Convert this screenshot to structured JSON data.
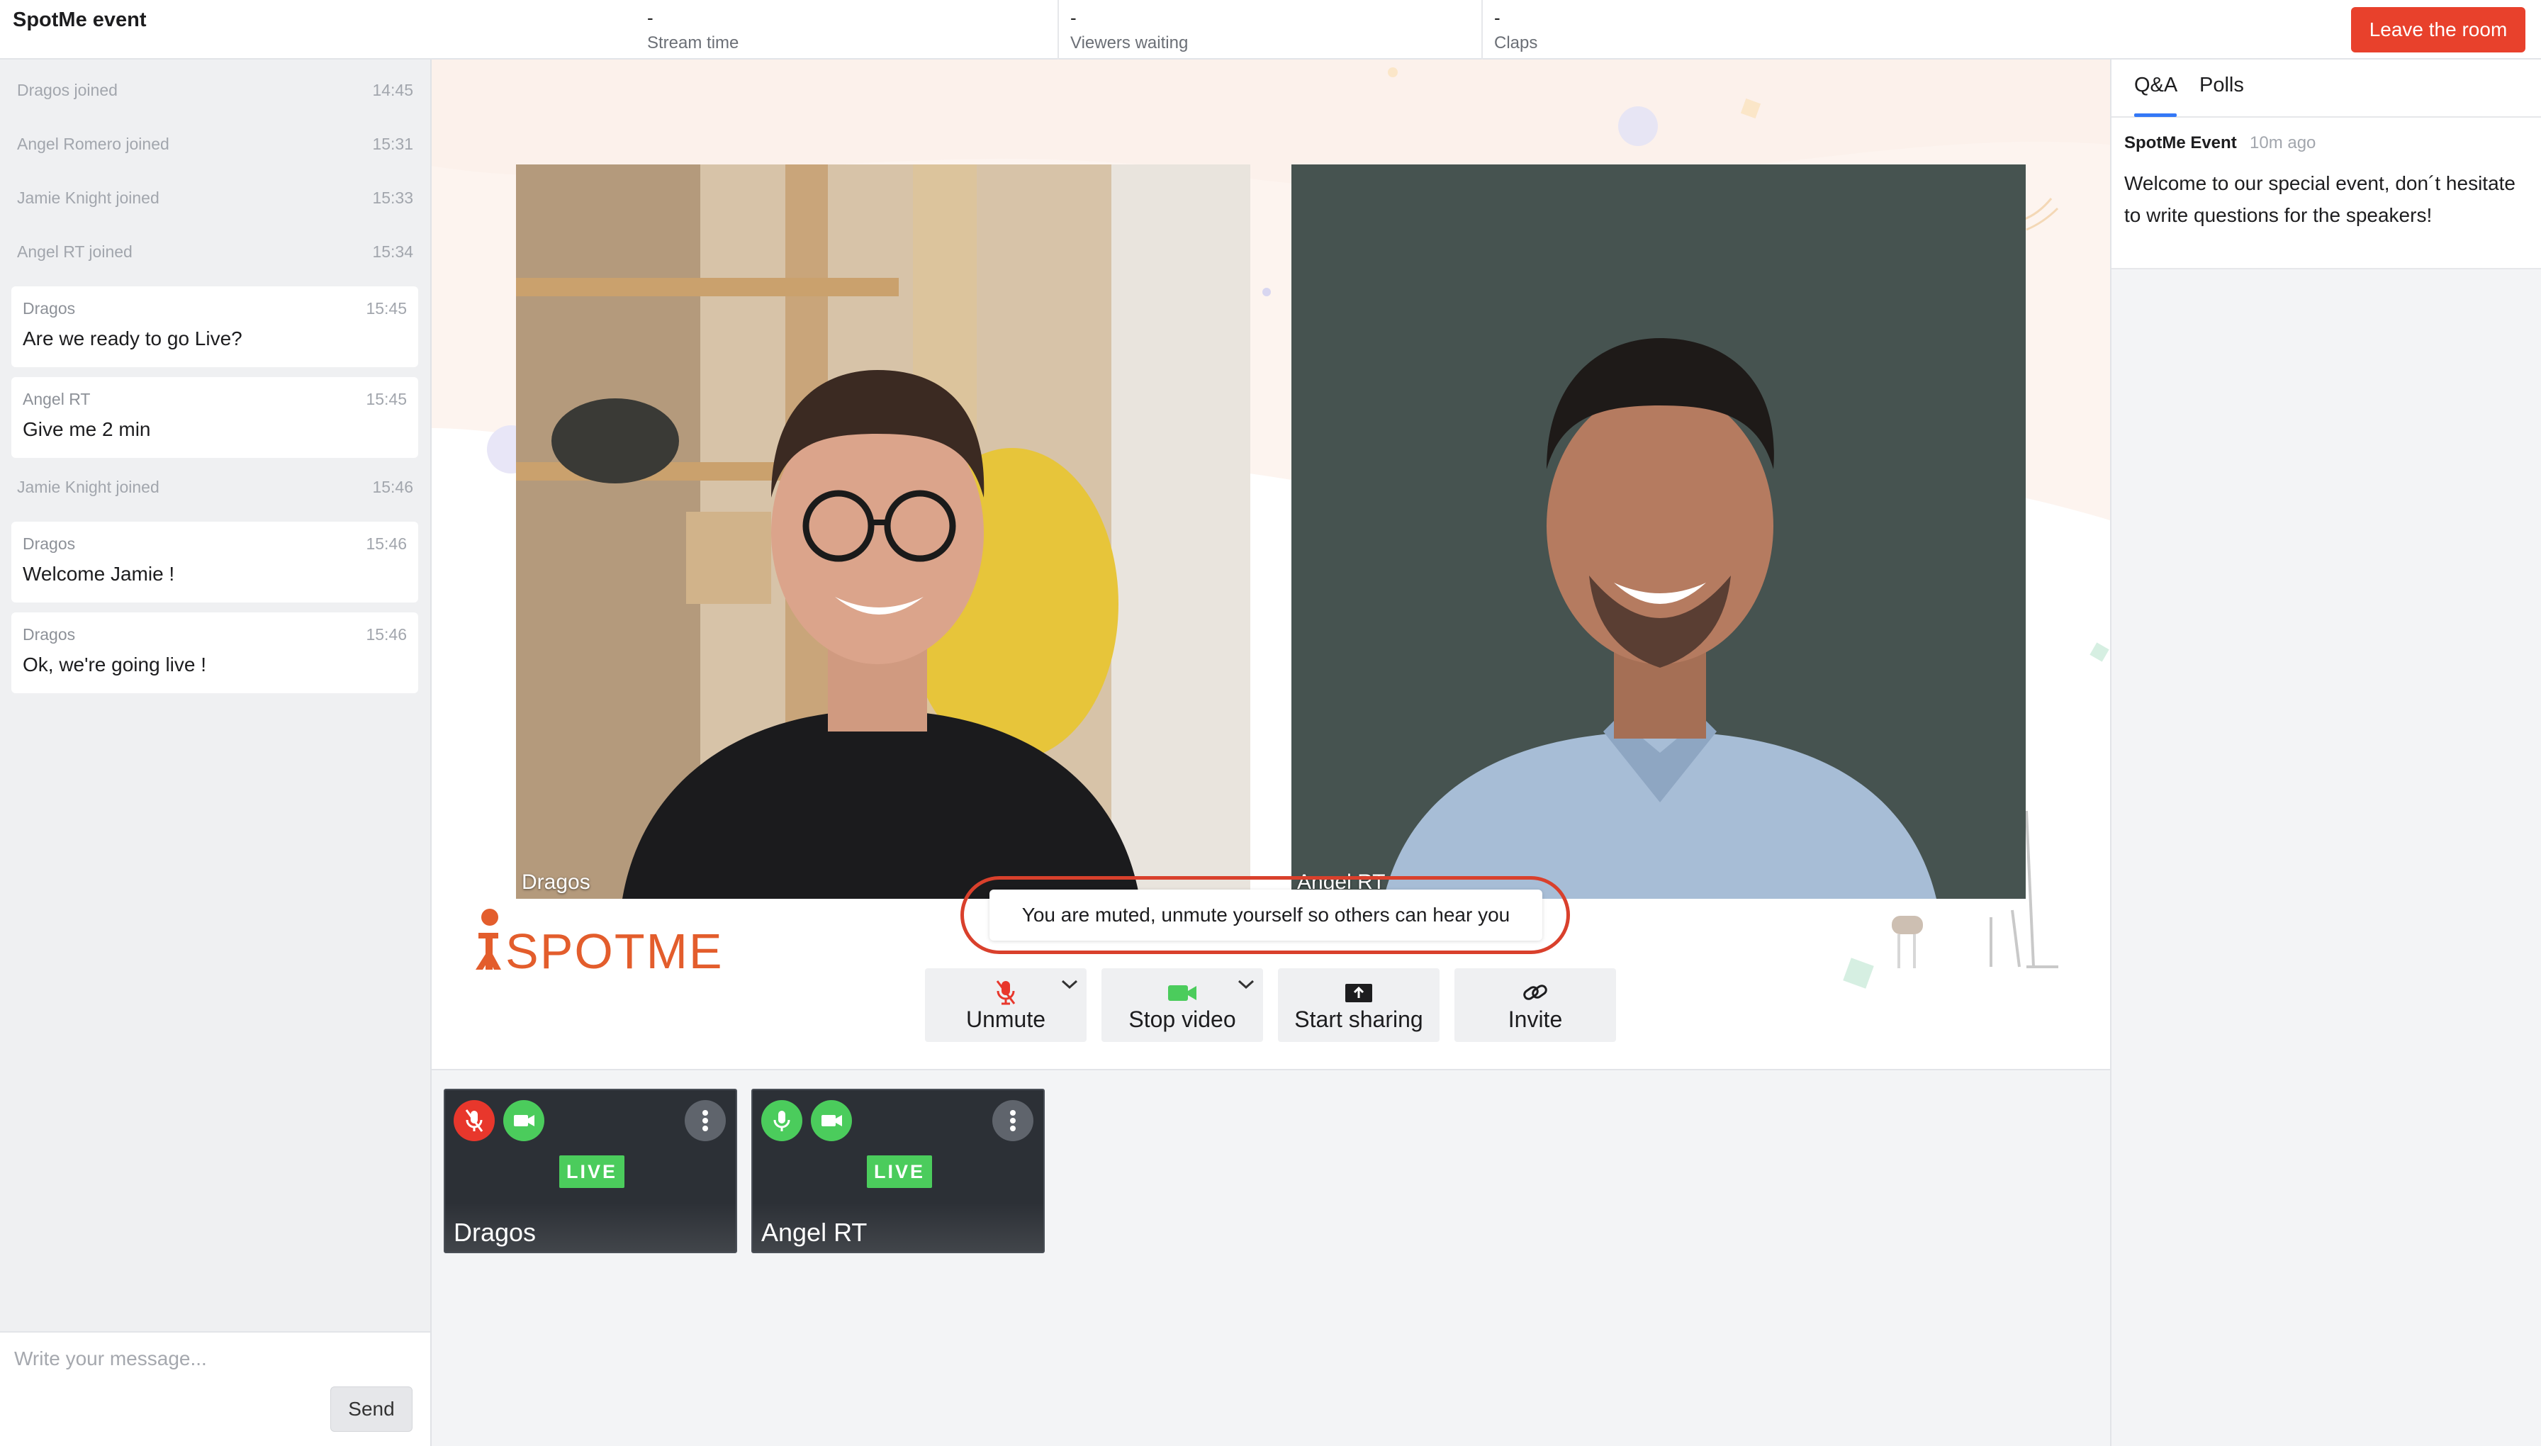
{
  "header": {
    "event_title": "SpotMe event",
    "stats": [
      {
        "value": "-",
        "label": "Stream time"
      },
      {
        "value": "-",
        "label": "Viewers waiting"
      },
      {
        "value": "-",
        "label": "Claps"
      }
    ],
    "leave_label": "Leave the room"
  },
  "chat": {
    "entries": [
      {
        "type": "system",
        "text": "Dragos joined",
        "time": "14:45"
      },
      {
        "type": "system",
        "text": "Angel Romero joined",
        "time": "15:31"
      },
      {
        "type": "system",
        "text": "Jamie Knight joined",
        "time": "15:33"
      },
      {
        "type": "system",
        "text": "Angel RT joined",
        "time": "15:34"
      },
      {
        "type": "message",
        "author": "Dragos",
        "time": "15:45",
        "text": "Are we ready to go Live?"
      },
      {
        "type": "message",
        "author": "Angel RT",
        "time": "15:45",
        "text": "Give me 2 min"
      },
      {
        "type": "system",
        "text": "Jamie Knight joined",
        "time": "15:46"
      },
      {
        "type": "message",
        "author": "Dragos",
        "time": "15:46",
        "text": "Welcome Jamie !"
      },
      {
        "type": "message",
        "author": "Dragos",
        "time": "15:46",
        "text": "Ok, we're going live !"
      }
    ],
    "input_placeholder": "Write your message...",
    "send_label": "Send"
  },
  "stage": {
    "videos": [
      {
        "name": "Dragos"
      },
      {
        "name": "Angel RT"
      }
    ],
    "logo_text": "SPOTME",
    "muted_notice": "You are muted, unmute yourself so others can hear you",
    "controls": [
      {
        "label": "Unmute",
        "icon": "mic-off-icon"
      },
      {
        "label": "Stop video",
        "icon": "video-camera-icon"
      },
      {
        "label": "Start sharing",
        "icon": "screen-share-icon"
      },
      {
        "label": "Invite",
        "icon": "link-icon"
      }
    ]
  },
  "participants": [
    {
      "name": "Dragos",
      "badge": "LIVE",
      "mic": "muted",
      "video": "on"
    },
    {
      "name": "Angel RT",
      "badge": "LIVE",
      "mic": "on",
      "video": "on"
    }
  ],
  "sidebar": {
    "tabs": [
      "Q&A",
      "Polls"
    ],
    "active_tab": "Q&A",
    "qa": {
      "author": "SpotMe Event",
      "time": "10m ago",
      "text": "Welcome to our special event, don´t hesitate to write questions for the speakers!"
    }
  },
  "colors": {
    "leave_button": "#e8412c",
    "live_badge": "#4bcc5c",
    "muted_icon": "#e8372c",
    "active_icon": "#4bcc5c",
    "tab_underline": "#3478f6",
    "brand": "#e35d2c"
  }
}
